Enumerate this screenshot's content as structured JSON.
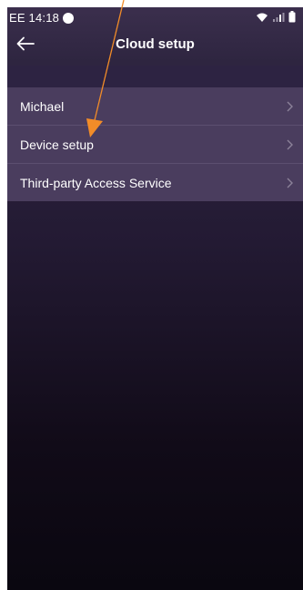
{
  "status_bar": {
    "carrier_time": "EE 14:18"
  },
  "header": {
    "title": "Cloud setup",
    "back_icon": "arrow-left-icon"
  },
  "menu": {
    "items": [
      {
        "label": "Michael",
        "icon": "chevron-right-icon"
      },
      {
        "label": "Device setup",
        "icon": "chevron-right-icon"
      },
      {
        "label": "Third-party Access Service",
        "icon": "chevron-right-icon"
      }
    ]
  },
  "colors": {
    "annotation_arrow": "#f28c28",
    "menu_item_bg": "#4a3d5e",
    "header_bg": "#3b2f4d"
  }
}
